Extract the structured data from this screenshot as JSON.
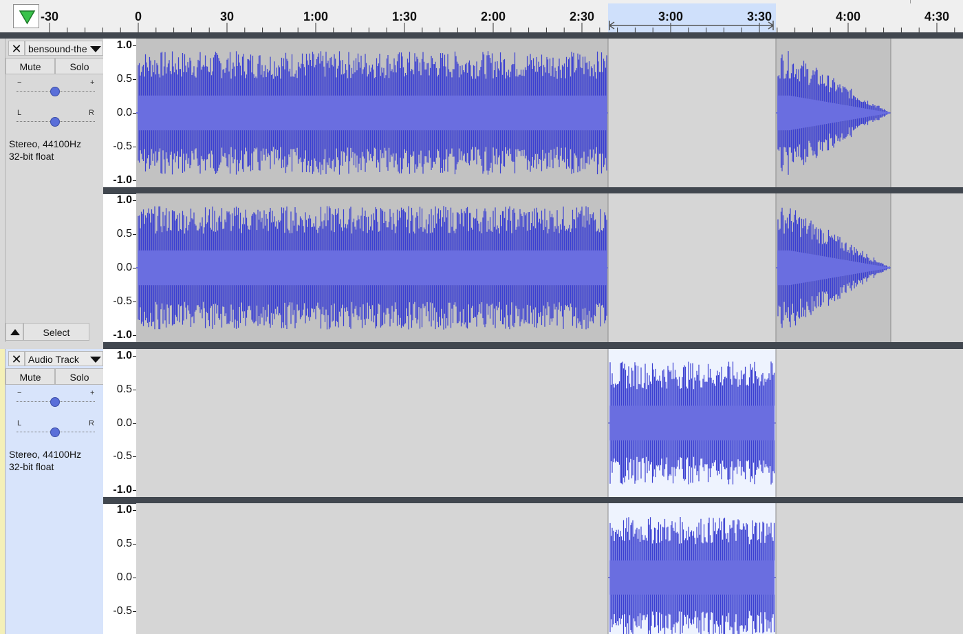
{
  "ruler": {
    "labels": [
      "-30",
      "0",
      "30",
      "1:00",
      "1:30",
      "2:00",
      "2:30",
      "3:00",
      "3:30",
      "4:00",
      "4:30"
    ],
    "selection_start": "2:40",
    "selection_end": "3:37"
  },
  "tracks": [
    {
      "name": "bensound-the",
      "mute_label": "Mute",
      "solo_label": "Solo",
      "gain_minus": "−",
      "gain_plus": "+",
      "pan_left": "L",
      "pan_right": "R",
      "format_line1": "Stereo, 44100Hz",
      "format_line2": "32-bit float",
      "select_label": "Select",
      "selected": false
    },
    {
      "name": "Audio Track",
      "mute_label": "Mute",
      "solo_label": "Solo",
      "gain_minus": "−",
      "gain_plus": "+",
      "pan_left": "L",
      "pan_right": "R",
      "format_line1": "Stereo, 44100Hz",
      "format_line2": "32-bit float",
      "selected": true
    }
  ],
  "scale_labels": [
    "1.0",
    "0.5",
    "0.0",
    "-0.5",
    "-1.0"
  ],
  "colors": {
    "waveform": "#3a3fd1",
    "waveform_rms": "#6a6ee0",
    "clip_background": "#c2c2c2",
    "selected_clip_background": "#eef3fe",
    "empty_background": "#d6d6d6",
    "selected_track_panel": "#d8e4fb",
    "play_triangle": "#39c24a"
  }
}
